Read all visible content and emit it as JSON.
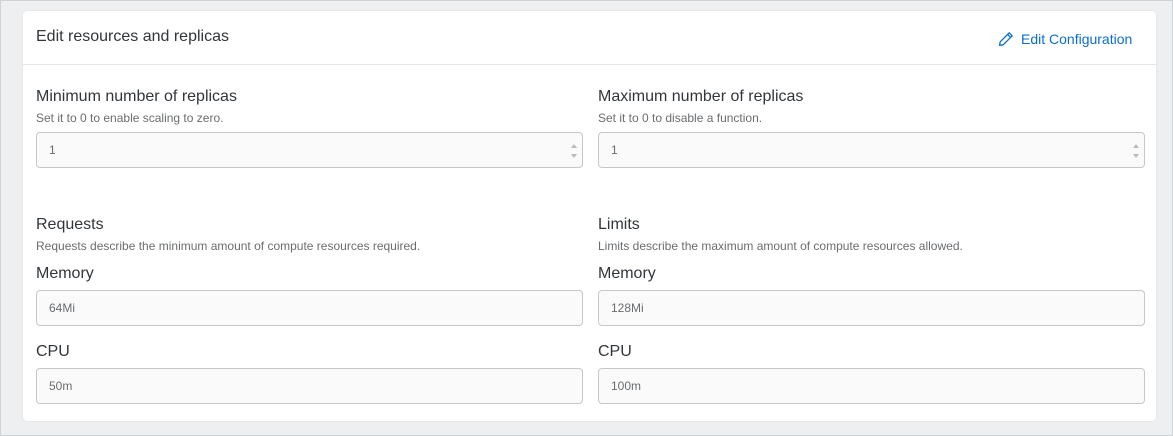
{
  "panel": {
    "title": "Edit resources and replicas",
    "edit_button_label": "Edit Configuration",
    "edit_icon": "pencil-icon",
    "accent_color": "#0a6ed1"
  },
  "replicas": {
    "min": {
      "label": "Minimum number of replicas",
      "description": "Set it to 0 to enable scaling to zero.",
      "value": "1"
    },
    "max": {
      "label": "Maximum number of replicas",
      "description": "Set it to 0 to disable a function.",
      "value": "1"
    }
  },
  "requests": {
    "title": "Requests",
    "description": "Requests describe the minimum amount of compute resources required.",
    "memory_label": "Memory",
    "memory_value": "64Mi",
    "cpu_label": "CPU",
    "cpu_value": "50m"
  },
  "limits": {
    "title": "Limits",
    "description": "Limits describe the maximum amount of compute resources allowed.",
    "memory_label": "Memory",
    "memory_value": "128Mi",
    "cpu_label": "CPU",
    "cpu_value": "100m"
  }
}
